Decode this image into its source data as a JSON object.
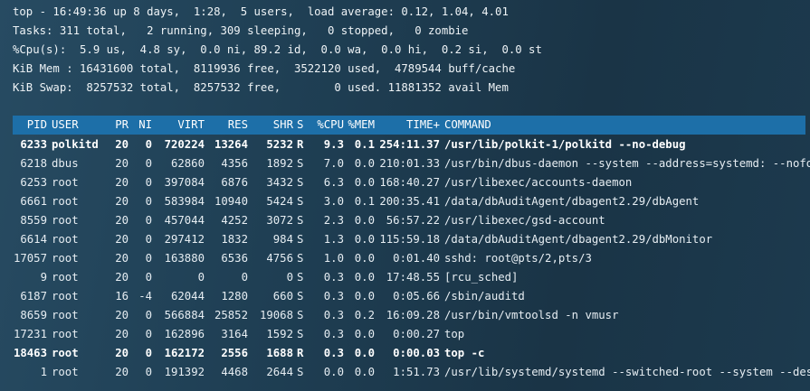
{
  "summary": {
    "line1": "top - 16:49:36 up 8 days,  1:28,  5 users,  load average: 0.12, 1.04, 4.01",
    "line2": "Tasks: 311 total,   2 running, 309 sleeping,   0 stopped,   0 zombie",
    "line3": "%Cpu(s):  5.9 us,  4.8 sy,  0.0 ni, 89.2 id,  0.0 wa,  0.0 hi,  0.2 si,  0.0 st",
    "line4": "KiB Mem : 16431600 total,  8119936 free,  3522120 used,  4789544 buff/cache",
    "line5": "KiB Swap:  8257532 total,  8257532 free,        0 used. 11881352 avail Mem"
  },
  "columns": {
    "pid": "PID",
    "user": "USER",
    "pr": "PR",
    "ni": "NI",
    "virt": "VIRT",
    "res": "RES",
    "shr": "SHR",
    "s": "S",
    "cpu": "%CPU",
    "mem": "%MEM",
    "time": "TIME+",
    "command": "COMMAND"
  },
  "processes": [
    {
      "pid": "6233",
      "user": "polkitd",
      "pr": "20",
      "ni": "0",
      "virt": "720224",
      "res": "13264",
      "shr": "5232",
      "s": "R",
      "cpu": "9.3",
      "mem": "0.1",
      "time": "254:11.37",
      "command": "/usr/lib/polkit-1/polkitd --no-debug",
      "bold": true
    },
    {
      "pid": "6218",
      "user": "dbus",
      "pr": "20",
      "ni": "0",
      "virt": "62860",
      "res": "4356",
      "shr": "1892",
      "s": "S",
      "cpu": "7.0",
      "mem": "0.0",
      "time": "210:01.33",
      "command": "/usr/bin/dbus-daemon --system --address=systemd: --nofo+",
      "bold": false
    },
    {
      "pid": "6253",
      "user": "root",
      "pr": "20",
      "ni": "0",
      "virt": "397084",
      "res": "6876",
      "shr": "3432",
      "s": "S",
      "cpu": "6.3",
      "mem": "0.0",
      "time": "168:40.27",
      "command": "/usr/libexec/accounts-daemon",
      "bold": false
    },
    {
      "pid": "6661",
      "user": "root",
      "pr": "20",
      "ni": "0",
      "virt": "583984",
      "res": "10940",
      "shr": "5424",
      "s": "S",
      "cpu": "3.0",
      "mem": "0.1",
      "time": "200:35.41",
      "command": "/data/dbAuditAgent/dbagent2.29/dbAgent",
      "bold": false
    },
    {
      "pid": "8559",
      "user": "root",
      "pr": "20",
      "ni": "0",
      "virt": "457044",
      "res": "4252",
      "shr": "3072",
      "s": "S",
      "cpu": "2.3",
      "mem": "0.0",
      "time": "56:57.22",
      "command": "/usr/libexec/gsd-account",
      "bold": false
    },
    {
      "pid": "6614",
      "user": "root",
      "pr": "20",
      "ni": "0",
      "virt": "297412",
      "res": "1832",
      "shr": "984",
      "s": "S",
      "cpu": "1.3",
      "mem": "0.0",
      "time": "115:59.18",
      "command": "/data/dbAuditAgent/dbagent2.29/dbMonitor",
      "bold": false
    },
    {
      "pid": "17057",
      "user": "root",
      "pr": "20",
      "ni": "0",
      "virt": "163880",
      "res": "6536",
      "shr": "4756",
      "s": "S",
      "cpu": "1.0",
      "mem": "0.0",
      "time": "0:01.40",
      "command": "sshd: root@pts/2,pts/3",
      "bold": false
    },
    {
      "pid": "9",
      "user": "root",
      "pr": "20",
      "ni": "0",
      "virt": "0",
      "res": "0",
      "shr": "0",
      "s": "S",
      "cpu": "0.3",
      "mem": "0.0",
      "time": "17:48.55",
      "command": "[rcu_sched]",
      "bold": false
    },
    {
      "pid": "6187",
      "user": "root",
      "pr": "16",
      "ni": "-4",
      "virt": "62044",
      "res": "1280",
      "shr": "660",
      "s": "S",
      "cpu": "0.3",
      "mem": "0.0",
      "time": "0:05.66",
      "command": "/sbin/auditd",
      "bold": false
    },
    {
      "pid": "8659",
      "user": "root",
      "pr": "20",
      "ni": "0",
      "virt": "566884",
      "res": "25852",
      "shr": "19068",
      "s": "S",
      "cpu": "0.3",
      "mem": "0.2",
      "time": "16:09.28",
      "command": "/usr/bin/vmtoolsd -n vmusr",
      "bold": false
    },
    {
      "pid": "17231",
      "user": "root",
      "pr": "20",
      "ni": "0",
      "virt": "162896",
      "res": "3164",
      "shr": "1592",
      "s": "S",
      "cpu": "0.3",
      "mem": "0.0",
      "time": "0:00.27",
      "command": "top",
      "bold": false
    },
    {
      "pid": "18463",
      "user": "root",
      "pr": "20",
      "ni": "0",
      "virt": "162172",
      "res": "2556",
      "shr": "1688",
      "s": "R",
      "cpu": "0.3",
      "mem": "0.0",
      "time": "0:00.03",
      "command": "top -c",
      "bold": true
    },
    {
      "pid": "1",
      "user": "root",
      "pr": "20",
      "ni": "0",
      "virt": "191392",
      "res": "4468",
      "shr": "2644",
      "s": "S",
      "cpu": "0.0",
      "mem": "0.0",
      "time": "1:51.73",
      "command": "/usr/lib/systemd/systemd --switched-root --system --des+",
      "bold": false
    }
  ]
}
